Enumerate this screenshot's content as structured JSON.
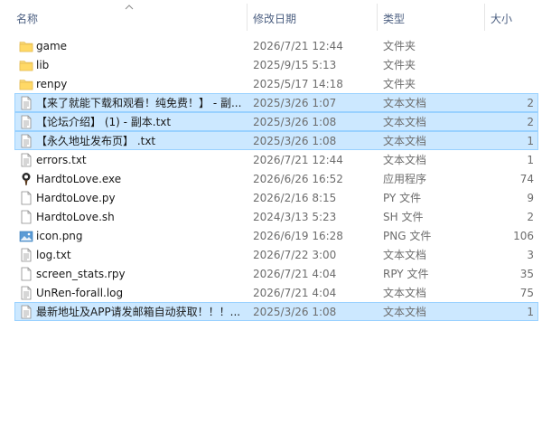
{
  "columns": {
    "name": "名称",
    "date": "修改日期",
    "type": "类型",
    "size": "大小"
  },
  "files": [
    {
      "icon": "folder-icon",
      "name": "game",
      "date": "2026/7/21 12:44",
      "type": "文件夹",
      "size": "",
      "selected": false
    },
    {
      "icon": "folder-icon",
      "name": "lib",
      "date": "2025/9/15 5:13",
      "type": "文件夹",
      "size": "",
      "selected": false
    },
    {
      "icon": "folder-icon",
      "name": "renpy",
      "date": "2025/5/17 14:18",
      "type": "文件夹",
      "size": "",
      "selected": false
    },
    {
      "icon": "text-file-icon",
      "name": "【来了就能下载和观看！纯免费！】 - 副...",
      "date": "2025/3/26 1:07",
      "type": "文本文档",
      "size": "2",
      "selected": true
    },
    {
      "icon": "text-file-icon",
      "name": "【论坛介绍】 (1) - 副本.txt",
      "date": "2025/3/26 1:08",
      "type": "文本文档",
      "size": "2",
      "selected": true
    },
    {
      "icon": "text-file-icon",
      "name": "【永久地址发布页】 .txt",
      "date": "2025/3/26 1:08",
      "type": "文本文档",
      "size": "1",
      "selected": true
    },
    {
      "icon": "text-file-icon",
      "name": "errors.txt",
      "date": "2026/7/21 12:44",
      "type": "文本文档",
      "size": "1",
      "selected": false
    },
    {
      "icon": "exe-file-icon",
      "name": "HardtoLove.exe",
      "date": "2026/6/26 16:52",
      "type": "应用程序",
      "size": "74",
      "selected": false
    },
    {
      "icon": "blank-file-icon",
      "name": "HardtoLove.py",
      "date": "2026/2/16 8:15",
      "type": "PY 文件",
      "size": "9",
      "selected": false
    },
    {
      "icon": "blank-file-icon",
      "name": "HardtoLove.sh",
      "date": "2024/3/13 5:23",
      "type": "SH 文件",
      "size": "2",
      "selected": false
    },
    {
      "icon": "image-file-icon",
      "name": "icon.png",
      "date": "2026/6/19 16:28",
      "type": "PNG 文件",
      "size": "106",
      "selected": false
    },
    {
      "icon": "text-file-icon",
      "name": "log.txt",
      "date": "2026/7/22 3:00",
      "type": "文本文档",
      "size": "3",
      "selected": false
    },
    {
      "icon": "blank-file-icon",
      "name": "screen_stats.rpy",
      "date": "2026/7/21 4:04",
      "type": "RPY 文件",
      "size": "35",
      "selected": false
    },
    {
      "icon": "text-file-icon",
      "name": "UnRen-forall.log",
      "date": "2026/7/21 4:04",
      "type": "文本文档",
      "size": "75",
      "selected": false
    },
    {
      "icon": "text-file-icon",
      "name": "最新地址及APP请发邮箱自动获取！！！...",
      "date": "2025/3/26 1:08",
      "type": "文本文档",
      "size": "1",
      "selected": true
    }
  ]
}
